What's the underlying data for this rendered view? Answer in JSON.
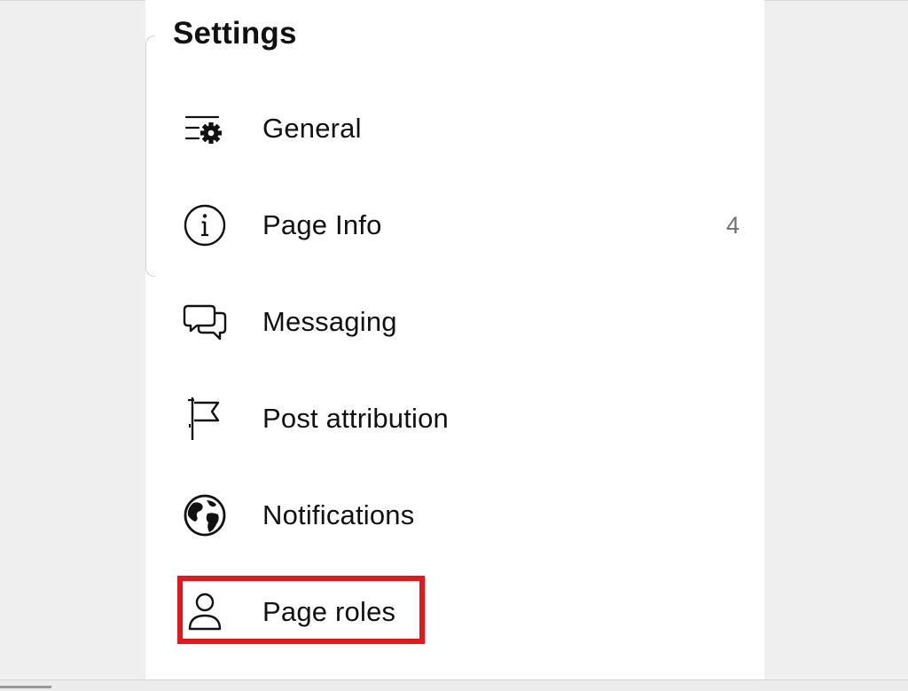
{
  "settings": {
    "title": "Settings",
    "items": [
      {
        "label": "General",
        "icon": "general-settings-icon"
      },
      {
        "label": "Page Info",
        "icon": "info-icon",
        "badge": "4"
      },
      {
        "label": "Messaging",
        "icon": "messaging-icon"
      },
      {
        "label": "Post attribution",
        "icon": "flag-icon"
      },
      {
        "label": "Notifications",
        "icon": "globe-icon"
      },
      {
        "label": "Page roles",
        "icon": "person-icon",
        "highlighted": true
      }
    ]
  },
  "colors": {
    "highlight": "#e8161b",
    "text": "#111111",
    "badge": "#707070",
    "panel": "#ffffff",
    "background": "#efefef"
  }
}
